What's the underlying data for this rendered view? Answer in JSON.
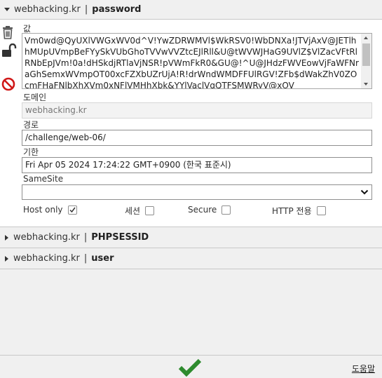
{
  "cookies": [
    {
      "domain": "webhacking.kr",
      "separator": "|",
      "name": "password"
    },
    {
      "domain": "webhacking.kr",
      "separator": "|",
      "name": "PHPSESSID"
    },
    {
      "domain": "webhacking.kr",
      "separator": "|",
      "name": "user"
    }
  ],
  "editor": {
    "value_label": "값",
    "value": "Vm0wd@QyUXlVWGxWV0d^V!YwZDRWMVl$WkRSV0!WbDNXa!JTVjAxV@JETlhhMUpUVmpBeFYySkVUbGhoTVVwVVZtcEJlRll&U@tWVWJHaG9UVlZ$VlZacVFtRlRNbEpJVm!0a!dHSkdjRTlaVjNSR!pVWmFkR0&GU@!^U@JHdzFWVEowVjFaWFNraGhSemxWVmpOT00xcFZXbUZrUjA!R!drWndWMDFFUlRGV!ZFb$dWakZhV0ZOcmFHaFNlbXhXVm0xNFlVMHhXbk&YYlVaclVqQTFSMWRyV@xOV",
    "domain_label": "도메인",
    "domain_value": "webhacking.kr",
    "path_label": "경로",
    "path_value": "/challenge/web-06/",
    "expiry_label": "기한",
    "expiry_value": "Fri Apr 05 2024 17:24:22 GMT+0900 (한국 표준시)",
    "samesite_label": "SameSite",
    "samesite_value": "",
    "options": [
      {
        "label": "Host only",
        "checked": true
      },
      {
        "label": "세션",
        "checked": false
      },
      {
        "label": "Secure",
        "checked": false
      },
      {
        "label": "HTTP 전용",
        "checked": false
      }
    ]
  },
  "side_icons": [
    "trash-icon",
    "unlock-icon",
    "block-icon"
  ],
  "footer": {
    "save_icon": "checkmark-icon",
    "help_label": "도움말"
  },
  "colors": {
    "save_green": "#2e8b2e",
    "block_red": "#d01818",
    "background": "#f0f0f0"
  }
}
